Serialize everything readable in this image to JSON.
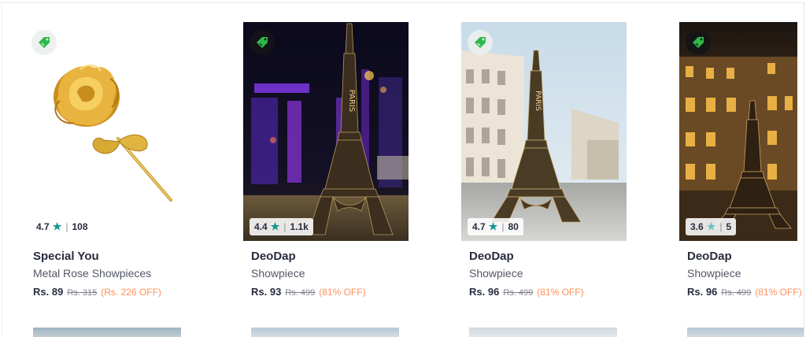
{
  "products": [
    {
      "brand": "Special You",
      "name": "Metal Rose Showpieces",
      "price": "Rs. 89",
      "mrp": "Rs. 315",
      "discount": "(Rs. 226 OFF)",
      "rating": "4.7",
      "rating_count": "108",
      "tag_style": "light",
      "image_icon": "golden-rose-image"
    },
    {
      "brand": "DeoDap",
      "name": "Showpiece",
      "price": "Rs. 93",
      "mrp": "Rs. 499",
      "discount": "(81% OFF)",
      "rating": "4.4",
      "rating_count": "1.1k",
      "tag_style": "dark",
      "image_icon": "eiffel-tower-night-image"
    },
    {
      "brand": "DeoDap",
      "name": "Showpiece",
      "price": "Rs. 96",
      "mrp": "Rs. 499",
      "discount": "(81% OFF)",
      "rating": "4.7",
      "rating_count": "80",
      "tag_style": "light",
      "image_icon": "eiffel-tower-street-image"
    },
    {
      "brand": "DeoDap",
      "name": "Showpiece",
      "price": "Rs. 96",
      "mrp": "Rs. 499",
      "discount": "(81% OFF)",
      "rating": "3.6",
      "rating_count": "5",
      "tag_style": "dark",
      "image_icon": "eiffel-tower-evening-image"
    }
  ],
  "colors": {
    "brand_text": "#282c3f",
    "product_text": "#535766",
    "mrp_text": "#7e818c",
    "discount_text": "#ff905a",
    "star": "#14958f",
    "tag_green": "#2fb84a"
  },
  "icons": {
    "rating_star": "★",
    "tag": "price-tag-icon"
  }
}
